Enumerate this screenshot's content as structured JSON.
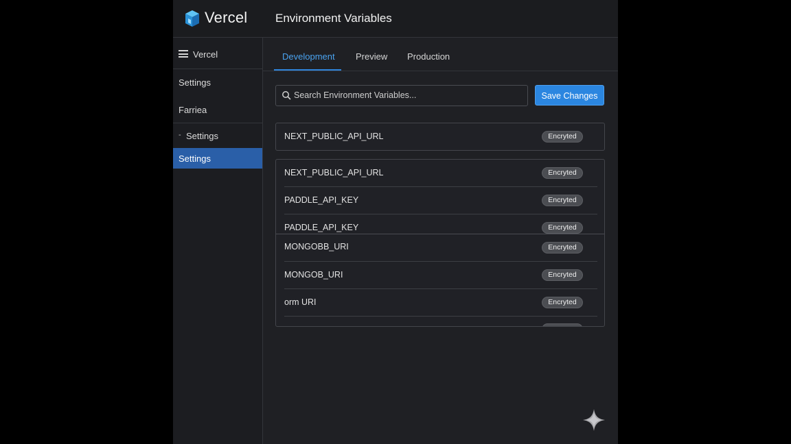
{
  "brand": {
    "name": "Vercel",
    "logo_icon": "vercel-cube-icon"
  },
  "header": {
    "title": "Environment Variables"
  },
  "sidebar": {
    "top_item": {
      "icon": "hamburger-icon",
      "label": "Vercel"
    },
    "items": [
      {
        "label": "Settings"
      },
      {
        "label": "Farriea"
      },
      {
        "label": "Settings"
      },
      {
        "label": "Settings",
        "active": true
      }
    ]
  },
  "tabs": [
    {
      "label": "Development",
      "active": true
    },
    {
      "label": "Preview"
    },
    {
      "label": "Production"
    }
  ],
  "search": {
    "placeholder": "Search Environment Variables..."
  },
  "actions": {
    "save_label": "Save Changes"
  },
  "variables": {
    "single": {
      "name": "NEXT_PUBLIC_API_URL",
      "badge": "Encryted"
    },
    "list": [
      {
        "name": "NEXT_PUBLIC_API_URL",
        "badge": "Encryted"
      },
      {
        "name": "PADDLE_API_KEY",
        "badge": "Encryted"
      },
      {
        "name": "PADDLE_API_KEY",
        "badge": "Encryted"
      },
      {
        "name": "MONGOBB_URI",
        "badge": "Encryted"
      },
      {
        "name": "MONGOB_URI",
        "badge": "Encryted"
      },
      {
        "name": "orm URI",
        "badge": "Encryted"
      }
    ]
  },
  "colors": {
    "accent": "#2b86e0",
    "active_nav": "#2a5fa8",
    "tab_active": "#4aa3f0"
  }
}
